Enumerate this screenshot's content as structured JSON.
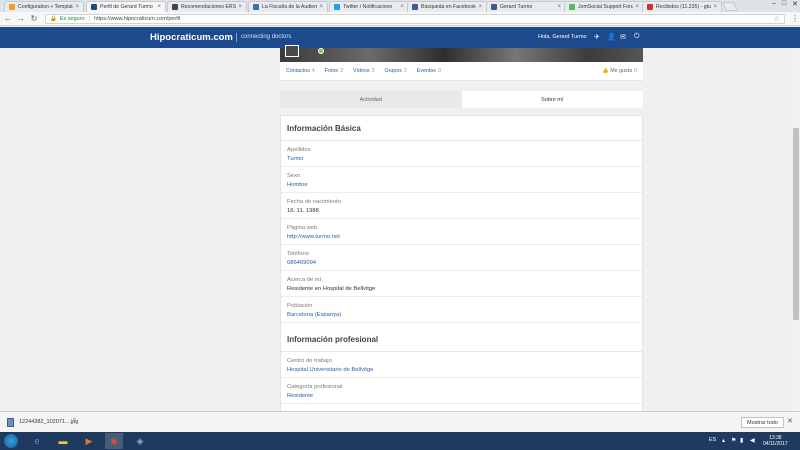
{
  "browser": {
    "tabs": [
      {
        "title": "Configuration » Templat",
        "favicon_color": "#f0a030",
        "active": false
      },
      {
        "title": "Perfil de Gerard Turmo",
        "favicon_color": "#1c4a8c",
        "active": true
      },
      {
        "title": "Recomendaciones ERS_",
        "favicon_color": "#444444",
        "active": false
      },
      {
        "title": "La Fiscalía de la Audien",
        "favicon_color": "#3b6fb6",
        "active": false
      },
      {
        "title": "Twitter / Notificacione",
        "favicon_color": "#1da1f2",
        "active": false
      },
      {
        "title": "Búsqueda en Facebook",
        "favicon_color": "#3b5998",
        "active": false
      },
      {
        "title": "Gerard Turmo",
        "favicon_color": "#3b5998",
        "active": false
      },
      {
        "title": "JomSocial Support Foru",
        "favicon_color": "#5cb85c",
        "active": false
      },
      {
        "title": "Recibidos (11.235) - gtu",
        "favicon_color": "#d93025",
        "active": false
      }
    ],
    "secure_label": "Es seguro",
    "url": "https://www.hipocraticum.com/perfil"
  },
  "site": {
    "brand": "Hipocraticum.com",
    "tagline": "connecting doctors",
    "greeting": "Hola, Gerard Turmo"
  },
  "profile_tabs": [
    {
      "label": "Contactos",
      "count": "4"
    },
    {
      "label": "Fotos",
      "count": "2"
    },
    {
      "label": "Vídeos",
      "count": "3"
    },
    {
      "label": "Grupos",
      "count": "2"
    },
    {
      "label": "Eventos",
      "count": "0"
    }
  ],
  "likes": {
    "label": "Me gusta",
    "count": "0"
  },
  "sub_tabs": {
    "activity": "Actividad",
    "about": "Sobre mí"
  },
  "basic_info": {
    "title": "Información Básica",
    "fields": [
      {
        "label": "Apellidos",
        "value": "Turmo",
        "link": true
      },
      {
        "label": "Sexo",
        "value": "Hombre",
        "link": true
      },
      {
        "label": "Fecha de nacimiento",
        "value": "16. 11. 1988",
        "link": false
      },
      {
        "label": "Página web",
        "value": "http://www.turmo.net",
        "link": true
      },
      {
        "label": "Teléfono",
        "value": "686469094",
        "link": true
      },
      {
        "label": "Acerca de mí",
        "value": "Residente en Hospital de Bellvitge",
        "link": false
      },
      {
        "label": "Población",
        "value": "Barcelona (Espanya)",
        "link": true
      }
    ]
  },
  "professional_info": {
    "title": "Información profesional",
    "fields": [
      {
        "label": "Centro de trabajo",
        "value": "Hospital Universitario de Bellvitge",
        "link": true
      },
      {
        "label": "Categoría profesional",
        "value": "Residente",
        "link": true
      }
    ]
  },
  "downloads": {
    "file": "12244382_102071....jpg",
    "show_all": "Mostrar todo"
  },
  "taskbar": {
    "lang": "ES",
    "time": "13:38",
    "date": "04/11/2017"
  }
}
